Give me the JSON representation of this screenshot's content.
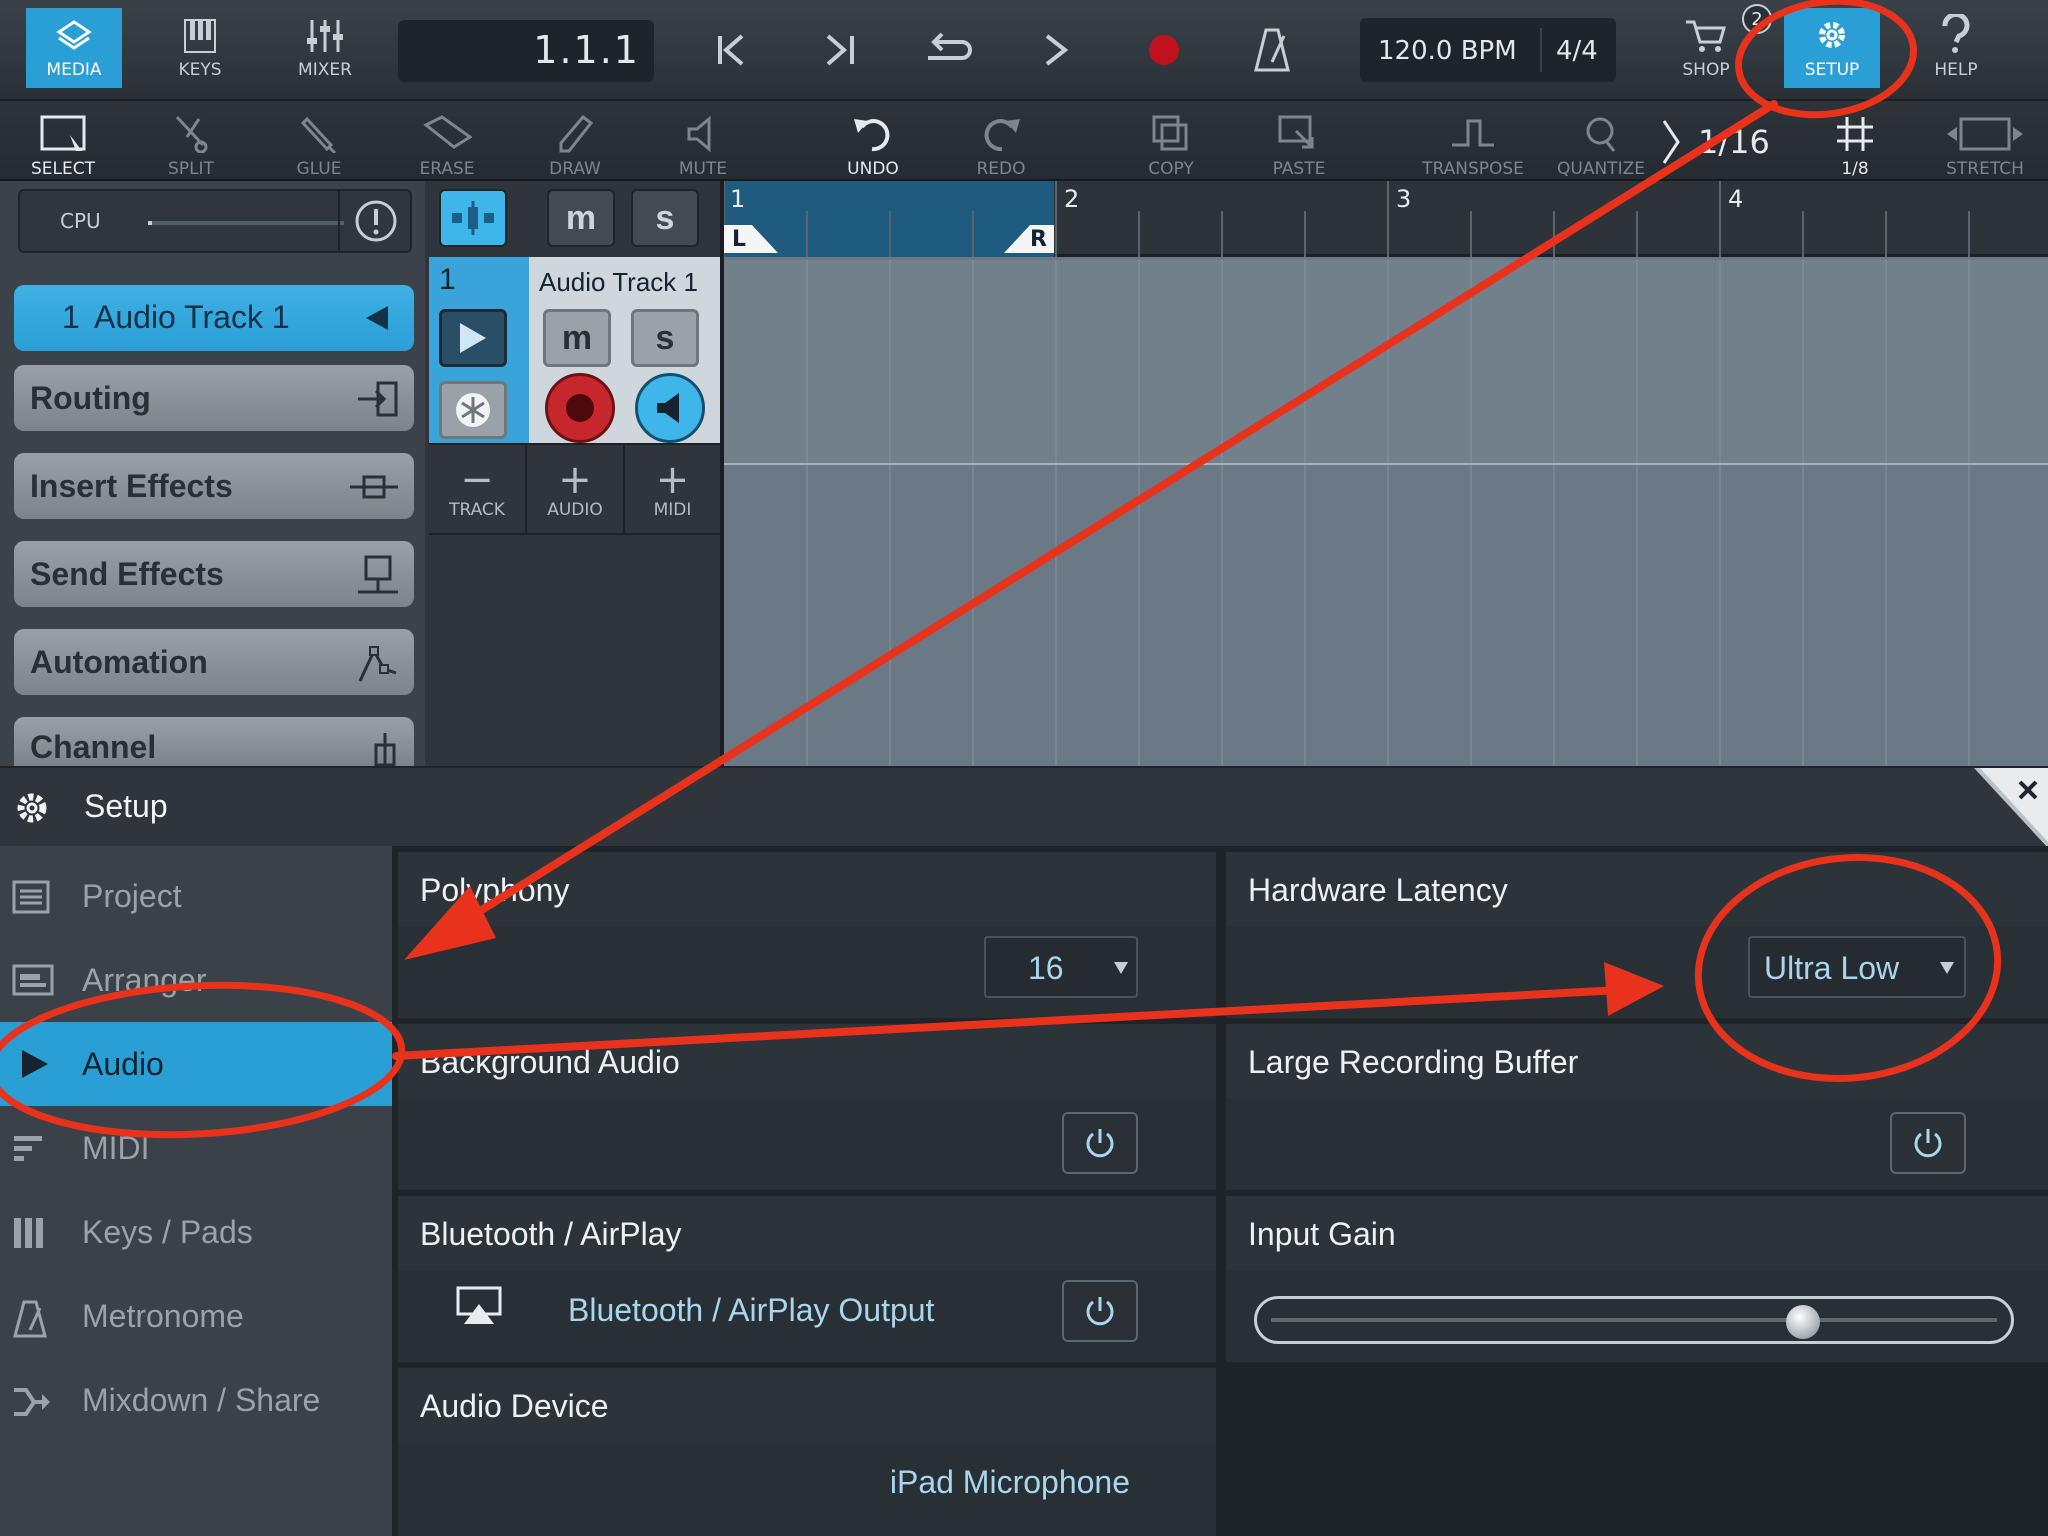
{
  "topbar": {
    "tabs": [
      {
        "label": "MEDIA"
      },
      {
        "label": "KEYS"
      },
      {
        "label": "MIXER"
      }
    ],
    "position": "1.1.1",
    "tempo": "120.0 BPM",
    "time_signature": "4/4",
    "shop_label": "SHOP",
    "shop_badge": "2",
    "setup_label": "SETUP",
    "help_label": "HELP"
  },
  "toolbar": {
    "select": "SELECT",
    "split": "SPLIT",
    "glue": "GLUE",
    "erase": "ERASE",
    "draw": "DRAW",
    "mute": "MUTE",
    "undo": "UNDO",
    "redo": "REDO",
    "copy": "COPY",
    "paste": "PASTE",
    "transpose": "TRANSPOSE",
    "quantize": "QUANTIZE",
    "quantize_value": "1/16",
    "grid_value": "1/8",
    "stretch": "STRETCH"
  },
  "inspector": {
    "cpu_label": "CPU",
    "cpu_level": 0.02,
    "track_number": "1",
    "track_name": "Audio Track 1",
    "buttons": [
      "Routing",
      "Insert Effects",
      "Send Effects",
      "Automation",
      "Channel"
    ]
  },
  "track": {
    "number": "1",
    "name": "Audio Track 1",
    "mute_glyph": "m",
    "solo_glyph": "s",
    "actions": [
      {
        "symbol": "−",
        "label": "TRACK"
      },
      {
        "symbol": "+",
        "label": "AUDIO"
      },
      {
        "symbol": "+",
        "label": "MIDI"
      }
    ]
  },
  "timeline": {
    "bars": [
      "1",
      "2",
      "3",
      "4"
    ],
    "loop_left": "L",
    "loop_right": "R"
  },
  "setup": {
    "title": "Setup",
    "nav": [
      {
        "label": "Project",
        "icon": "project-icon"
      },
      {
        "label": "Arranger",
        "icon": "arranger-icon"
      },
      {
        "label": "Audio",
        "icon": "play-icon",
        "selected": true
      },
      {
        "label": "MIDI",
        "icon": "midi-icon"
      },
      {
        "label": "Keys / Pads",
        "icon": "keys-icon"
      },
      {
        "label": "Metronome",
        "icon": "metronome-icon"
      },
      {
        "label": "Mixdown / Share",
        "icon": "share-icon"
      }
    ],
    "polyphony": {
      "title": "Polyphony",
      "value": "16"
    },
    "hardware_latency": {
      "title": "Hardware Latency",
      "value": "Ultra Low"
    },
    "background_audio": {
      "title": "Background Audio"
    },
    "large_recording_buffer": {
      "title": "Large Recording Buffer"
    },
    "bluetooth": {
      "title": "Bluetooth / AirPlay",
      "output_label": "Bluetooth / AirPlay Output"
    },
    "input_gain": {
      "title": "Input Gain",
      "level": 0.74
    },
    "audio_device": {
      "title": "Audio Device",
      "value": "iPad Microphone"
    }
  },
  "colors": {
    "accent": "#2a9fd6",
    "annotation": "#e8321c",
    "record": "#c0121c"
  }
}
